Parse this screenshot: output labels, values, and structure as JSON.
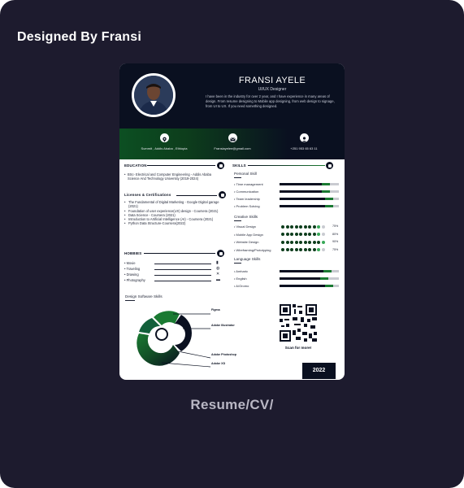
{
  "page": {
    "header_label": "Designed By Fransi",
    "caption": "Resume/CV/"
  },
  "resume": {
    "name": "FRANSI AYELE",
    "role": "UI/UX Designer",
    "bio": "I have been in the industry for over 2 year, and I have experience in many areas of design. From resume designing to Mobile app designing, from web design to signage, from UI to UX. If you need something designed.",
    "contact": {
      "location": "Summit , Addis Ababa , Ethiopia",
      "email": "Fransiayelee@gmail.com",
      "phone": "+251 953 65 63 11"
    },
    "education": {
      "title": "EDUCATION",
      "text": "BSc- Electrical and Computer Engineering - Addis Ababa Science And Technology University (2019-2024)"
    },
    "licenses": {
      "title": "Licenses & Certifications",
      "items": [
        "The Fundamental of Digital Marketing - Google Digital garage (2021)",
        "Foundation of user experience(UX) design - Coursera (2021)",
        "Data Science - Coursera (2021)",
        "Introduction to Artificial Intelligence (AI) - Coursera (2021)",
        "Python Data Structure-Coursera(2022)"
      ]
    },
    "hobbies": {
      "title": "HOBBIES",
      "items": [
        {
          "label": "Movie",
          "icon": "film-icon",
          "glyph": "▮"
        },
        {
          "label": "Traveling",
          "icon": "globe-icon",
          "glyph": "◍"
        },
        {
          "label": "Drawing",
          "icon": "pencil-icon",
          "glyph": "✕"
        },
        {
          "label": "Photography",
          "icon": "camera-icon",
          "glyph": "▬"
        }
      ]
    },
    "skills": {
      "title": "SKILLS",
      "personal": {
        "title": "Personal Skill",
        "items": [
          {
            "label": "Time management",
            "level": 0.85
          },
          {
            "label": "Communication",
            "level": 0.85
          },
          {
            "label": "Team leadership",
            "level": 0.9
          },
          {
            "label": "Problem Solving",
            "level": 0.9
          }
        ]
      },
      "creative": {
        "title": "Creative Skills",
        "items": [
          {
            "label": "Visual Design",
            "pct": "75%",
            "dots": 9
          },
          {
            "label": "Mobile App Design",
            "pct": "80%",
            "dots": 9
          },
          {
            "label": "Website Design",
            "pct": "90%",
            "dots": 10
          },
          {
            "label": "Wireframing/Prototyping",
            "pct": "75%",
            "dots": 9
          }
        ]
      },
      "language": {
        "title": "Language Skills",
        "items": [
          {
            "label": "Amharic",
            "level": 0.88
          },
          {
            "label": "English",
            "level": 0.82
          },
          {
            "label": "A/Oromo",
            "level": 0.9
          }
        ]
      }
    },
    "software": {
      "title": "Design Software Skills",
      "items": [
        "Figma",
        "Adobe Illustrator",
        "Adobe Photoshop",
        "Adobe XD"
      ]
    },
    "qr_caption": "Scan for more!",
    "year": "2022"
  },
  "colors": {
    "frame_bg": "#1d1b2e",
    "navy": "#0a1020",
    "green": "#1a7a32",
    "light_green": "#38a858"
  }
}
